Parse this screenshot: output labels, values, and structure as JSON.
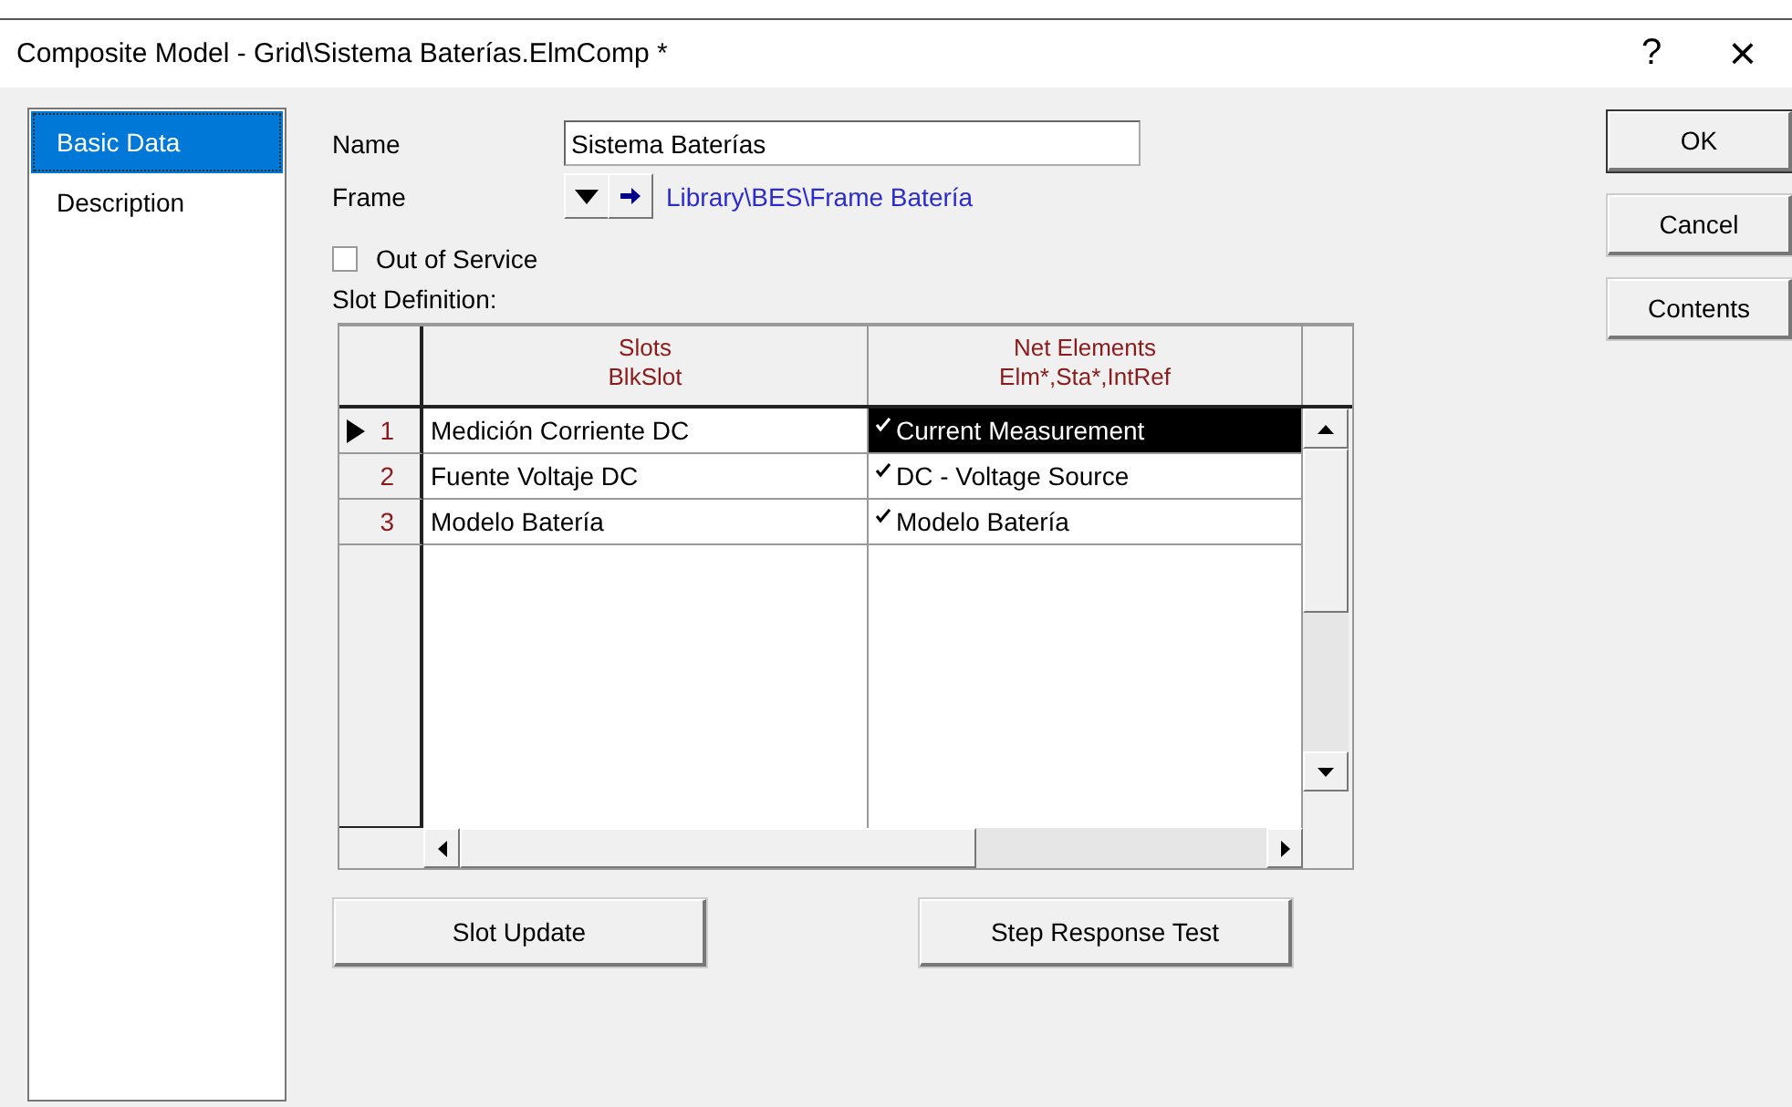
{
  "window": {
    "title": "Composite Model - Grid\\Sistema Baterías.ElmComp *",
    "help": "?",
    "close": "×"
  },
  "sidebar": {
    "items": [
      {
        "label": "Basic Data",
        "selected": true
      },
      {
        "label": "Description",
        "selected": false
      }
    ]
  },
  "name_field": {
    "label": "Name",
    "value": "Sistema Baterías"
  },
  "frame": {
    "label": "Frame",
    "link": "Library\\BES\\Frame Batería"
  },
  "out_of_service": {
    "label": "Out of Service",
    "checked": false
  },
  "slot_definition": {
    "label": "Slot Definition:",
    "columns": [
      {
        "title": "Slots",
        "subtitle": "BlkSlot"
      },
      {
        "title": "Net Elements",
        "subtitle": "Elm*,Sta*,IntRef"
      }
    ],
    "rows": [
      {
        "number": "1",
        "slot": "Medición Corriente DC",
        "element": "Current Measurement",
        "current": true,
        "selected": true
      },
      {
        "number": "2",
        "slot": "Fuente Voltaje DC",
        "element": "DC - Voltage Source",
        "current": false,
        "selected": false
      },
      {
        "number": "3",
        "slot": "Modelo Batería",
        "element": "Modelo Batería",
        "current": false,
        "selected": false
      }
    ]
  },
  "actions": [
    "Slot Update",
    "Step Response Test"
  ],
  "dialog_buttons": [
    {
      "label": "OK",
      "default": true
    },
    {
      "label": "Cancel",
      "default": false
    },
    {
      "label": "Contents",
      "default": false
    }
  ]
}
